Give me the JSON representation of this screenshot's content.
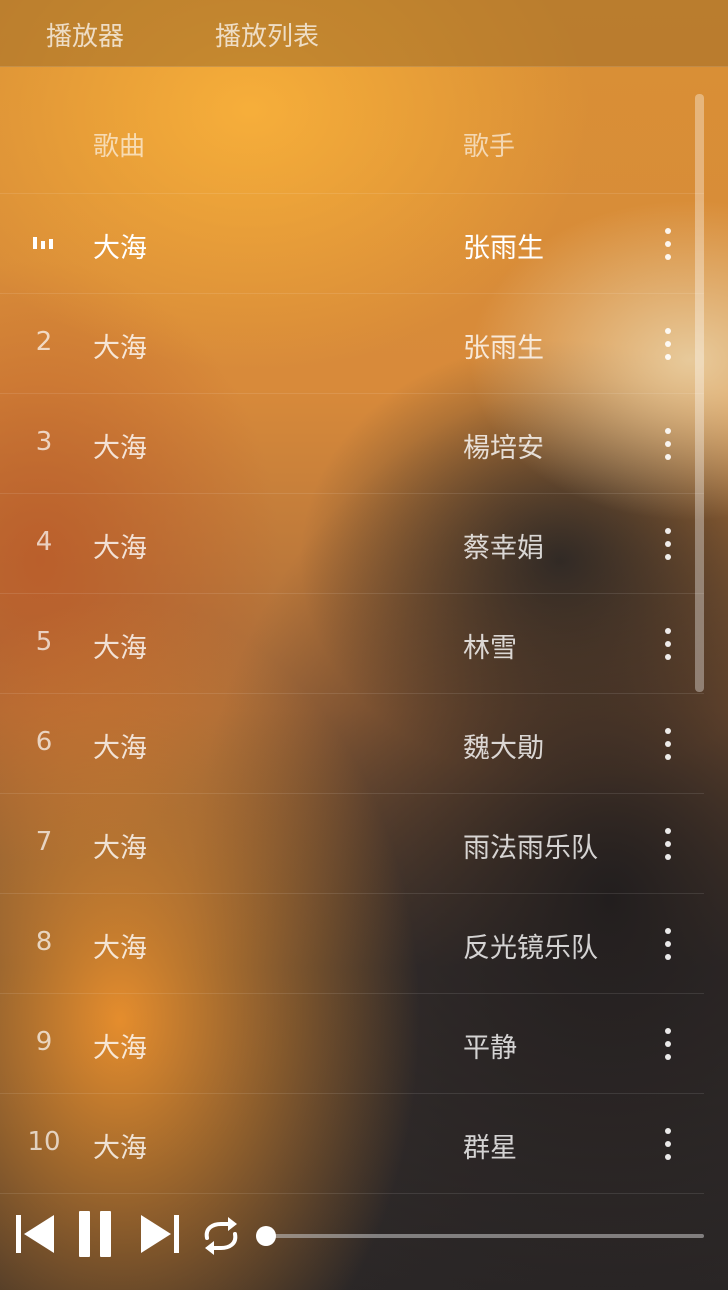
{
  "header": {
    "tabs": [
      {
        "label": "播放器"
      },
      {
        "label": "播放列表"
      }
    ]
  },
  "playlist": {
    "columns": {
      "song": "歌曲",
      "singer": "歌手"
    },
    "rows": [
      {
        "index": "1",
        "song": "大海",
        "singer": "张雨生",
        "playing": true
      },
      {
        "index": "2",
        "song": "大海",
        "singer": "张雨生"
      },
      {
        "index": "3",
        "song": "大海",
        "singer": "楊培安"
      },
      {
        "index": "4",
        "song": "大海",
        "singer": "蔡幸娟"
      },
      {
        "index": "5",
        "song": "大海",
        "singer": "林雪"
      },
      {
        "index": "6",
        "song": "大海",
        "singer": "魏大勛"
      },
      {
        "index": "7",
        "song": "大海",
        "singer": "雨法雨乐队"
      },
      {
        "index": "8",
        "song": "大海",
        "singer": "反光镜乐队"
      },
      {
        "index": "9",
        "song": "大海",
        "singer": "平静"
      },
      {
        "index": "10",
        "song": "大海",
        "singer": "群星"
      }
    ]
  },
  "controls": {
    "icons": [
      "skip-previous-icon",
      "pause-icon",
      "skip-next-icon",
      "repeat-icon"
    ],
    "progress": 0
  }
}
